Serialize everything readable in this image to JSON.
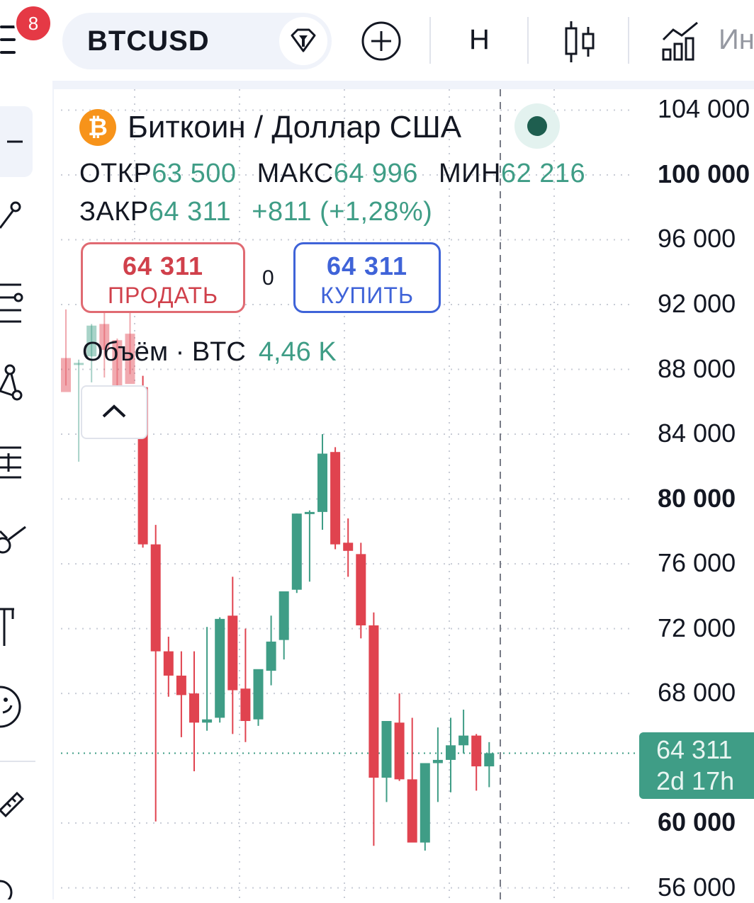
{
  "toolbar": {
    "notification_count": "8",
    "symbol": "BTCUSD",
    "interval": "H",
    "indicators_label": "Ин"
  },
  "legend": {
    "title": "Биткоин / Доллар США",
    "open_label": "ОТКР",
    "open_value": "63 500",
    "high_label": "МАКС",
    "high_value": "64 996",
    "low_label": "МИН",
    "low_value": "62 216",
    "close_label": "ЗАКР",
    "close_value": "64 311",
    "change": "+811 (+1,28%)",
    "market_status_color": "#1e5e4f"
  },
  "trade": {
    "sell_price": "64 311",
    "sell_label": "ПРОДАТЬ",
    "spread": "0",
    "buy_price": "64 311",
    "buy_label": "КУПИТЬ"
  },
  "volume": {
    "label": "Объём · BTC",
    "value": "4,46 K"
  },
  "price_tag": {
    "price": "64 311",
    "countdown": "2d 17h"
  },
  "colors": {
    "up": "#3f9d86",
    "down": "#e0434f",
    "sell": "#d0404b",
    "buy": "#3f63d8",
    "accent_bitcoin": "#f7931a"
  },
  "chart_data": {
    "type": "candlestick",
    "symbol": "BTCUSD",
    "interval": "H",
    "y_axis_ticks": [
      "104 000",
      "100 000",
      "96 000",
      "92 000",
      "88 000",
      "84 000",
      "80 000",
      "76 000",
      "72 000",
      "68 000",
      "64 311",
      "60 000",
      "56 000"
    ],
    "y_axis_values": [
      104000,
      100000,
      96000,
      92000,
      88000,
      84000,
      80000,
      76000,
      72000,
      68000,
      60000,
      56000
    ],
    "y_axis_bold": [
      100000,
      80000,
      60000
    ],
    "ylim": [
      54500,
      104500
    ],
    "last_price": 64311,
    "candles": [
      {
        "o": 88700,
        "h": 91700,
        "l": 87000,
        "c": 86600
      },
      {
        "o": 88400,
        "h": 88600,
        "l": 82300,
        "c": 88400
      },
      {
        "o": 88800,
        "h": 90800,
        "l": 87200,
        "c": 90700
      },
      {
        "o": 90800,
        "h": 92500,
        "l": 87500,
        "c": 89200
      },
      {
        "o": 89800,
        "h": 89900,
        "l": 86300,
        "c": 86300
      },
      {
        "o": 90200,
        "h": 91600,
        "l": 87700,
        "c": 87100
      },
      {
        "o": 86900,
        "h": 87600,
        "l": 77000,
        "c": 77200
      },
      {
        "o": 77200,
        "h": 78400,
        "l": 60100,
        "c": 70600
      },
      {
        "o": 70600,
        "h": 71500,
        "l": 67800,
        "c": 69100
      },
      {
        "o": 69100,
        "h": 70600,
        "l": 65300,
        "c": 67900
      },
      {
        "o": 68000,
        "h": 70600,
        "l": 63200,
        "c": 66200
      },
      {
        "o": 66200,
        "h": 72100,
        "l": 65700,
        "c": 66400
      },
      {
        "o": 66500,
        "h": 72700,
        "l": 66200,
        "c": 72600
      },
      {
        "o": 72800,
        "h": 75200,
        "l": 65500,
        "c": 68200
      },
      {
        "o": 68300,
        "h": 72000,
        "l": 65000,
        "c": 66300
      },
      {
        "o": 66400,
        "h": 69300,
        "l": 66000,
        "c": 69500
      },
      {
        "o": 69400,
        "h": 72800,
        "l": 68500,
        "c": 71200
      },
      {
        "o": 71300,
        "h": 74300,
        "l": 70100,
        "c": 74300
      },
      {
        "o": 74400,
        "h": 79100,
        "l": 74200,
        "c": 79100
      },
      {
        "o": 79100,
        "h": 79300,
        "l": 74900,
        "c": 79200
      },
      {
        "o": 79200,
        "h": 84000,
        "l": 78100,
        "c": 82800
      },
      {
        "o": 82900,
        "h": 83200,
        "l": 76900,
        "c": 77200
      },
      {
        "o": 77300,
        "h": 78800,
        "l": 75200,
        "c": 76800
      },
      {
        "o": 76600,
        "h": 77300,
        "l": 71400,
        "c": 72200
      },
      {
        "o": 72200,
        "h": 73000,
        "l": 58600,
        "c": 62800
      },
      {
        "o": 62800,
        "h": 66200,
        "l": 61300,
        "c": 66300
      },
      {
        "o": 66200,
        "h": 68000,
        "l": 62600,
        "c": 62700
      },
      {
        "o": 62700,
        "h": 66500,
        "l": 60800,
        "c": 58800
      },
      {
        "o": 58800,
        "h": 63400,
        "l": 58300,
        "c": 63700
      },
      {
        "o": 63700,
        "h": 65900,
        "l": 61300,
        "c": 63900
      },
      {
        "o": 63900,
        "h": 66500,
        "l": 61900,
        "c": 64800
      },
      {
        "o": 64800,
        "h": 67000,
        "l": 64300,
        "c": 65400
      },
      {
        "o": 65400,
        "h": 65500,
        "l": 62000,
        "c": 63500
      },
      {
        "o": 63500,
        "h": 64996,
        "l": 62216,
        "c": 64311
      }
    ]
  }
}
